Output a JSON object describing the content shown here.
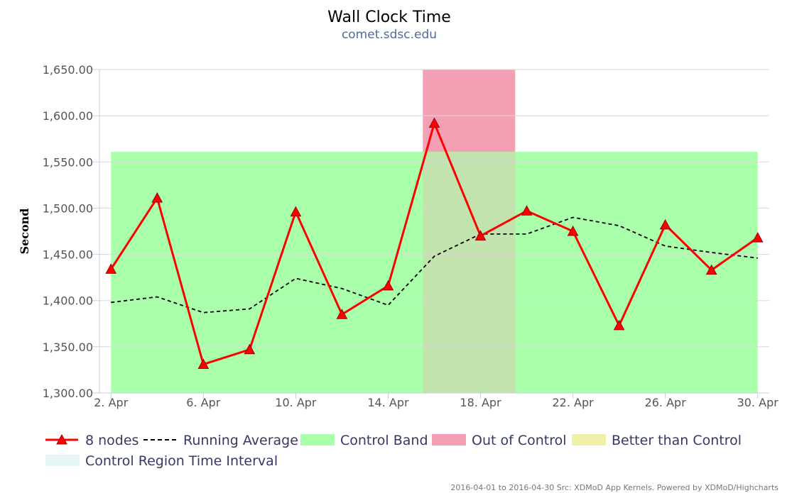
{
  "chart_data": {
    "type": "line",
    "title": "Wall Clock Time",
    "subtitle": "comet.sdsc.edu",
    "ylabel": "Second",
    "xlabel": "",
    "x": [
      "2016-04-02",
      "2016-04-04",
      "2016-04-06",
      "2016-04-08",
      "2016-04-10",
      "2016-04-12",
      "2016-04-14",
      "2016-04-16",
      "2016-04-18",
      "2016-04-20",
      "2016-04-22",
      "2016-04-24",
      "2016-04-26",
      "2016-04-28",
      "2016-04-30"
    ],
    "xlim": [
      "2016-04-01T12:00",
      "2016-04-30T12:00"
    ],
    "ylim": [
      1300,
      1650
    ],
    "yticks": [
      1300,
      1350,
      1400,
      1450,
      1500,
      1550,
      1600,
      1650
    ],
    "ytick_labels": [
      "1,300.00",
      "1,350.00",
      "1,400.00",
      "1,450.00",
      "1,500.00",
      "1,550.00",
      "1,600.00",
      "1,650.00"
    ],
    "xticks": [
      "2016-04-02",
      "2016-04-06",
      "2016-04-10",
      "2016-04-14",
      "2016-04-18",
      "2016-04-22",
      "2016-04-26",
      "2016-04-30"
    ],
    "xtick_labels": [
      "2. Apr",
      "6. Apr",
      "10. Apr",
      "14. Apr",
      "18. Apr",
      "22. Apr",
      "26. Apr",
      "30. Apr"
    ],
    "series": [
      {
        "name": "8 nodes",
        "style": "solid-line-triangle-markers",
        "color": "#ff0000",
        "values": [
          1434,
          1511,
          1331,
          1347,
          1496,
          1385,
          1416,
          1592,
          1470,
          1497,
          1475,
          1373,
          1482,
          1433,
          1468
        ]
      },
      {
        "name": "Running Average",
        "style": "dashed-line",
        "color": "#000000",
        "values": [
          1398,
          1404,
          1387,
          1391,
          1424,
          1413,
          1395,
          1448,
          1472,
          1472,
          1490,
          1481,
          1459,
          1452,
          1446
        ]
      }
    ],
    "bands": [
      {
        "name": "Control Band",
        "color": "#aaffaa",
        "from_date": "2016-04-02",
        "to_date": "2016-04-30",
        "y_from": 1300,
        "y_to": 1561
      },
      {
        "name": "Out of Control",
        "color": "#f4a0b4",
        "from_date": "2016-04-15T12:00",
        "to_date": "2016-04-19T12:00",
        "y_from": 1561,
        "y_to": 1650
      },
      {
        "name": "Out of Control overlap",
        "color": "#c2e2ae",
        "from_date": "2016-04-15T12:00",
        "to_date": "2016-04-19T12:00",
        "y_from": 1300,
        "y_to": 1561
      }
    ],
    "legend": {
      "placement": "bottom-left",
      "items": [
        {
          "name": "8 nodes",
          "kind": "line-triangle",
          "color": "#ff0000"
        },
        {
          "name": "Running Average",
          "kind": "dashed",
          "color": "#000000"
        },
        {
          "name": "Control Band",
          "kind": "box",
          "color": "#aaffaa"
        },
        {
          "name": "Out of Control",
          "kind": "box",
          "color": "#f4a0b4"
        },
        {
          "name": "Better than Control",
          "kind": "box",
          "color": "#f0f0a8"
        },
        {
          "name": "Control Region Time Interval",
          "kind": "box",
          "color": "#e4f6f8"
        }
      ]
    },
    "grid": true,
    "credits": "2016-04-01 to 2016-04-30 Src: XDMoD App Kernels. Powered by XDMoD/Highcharts"
  }
}
